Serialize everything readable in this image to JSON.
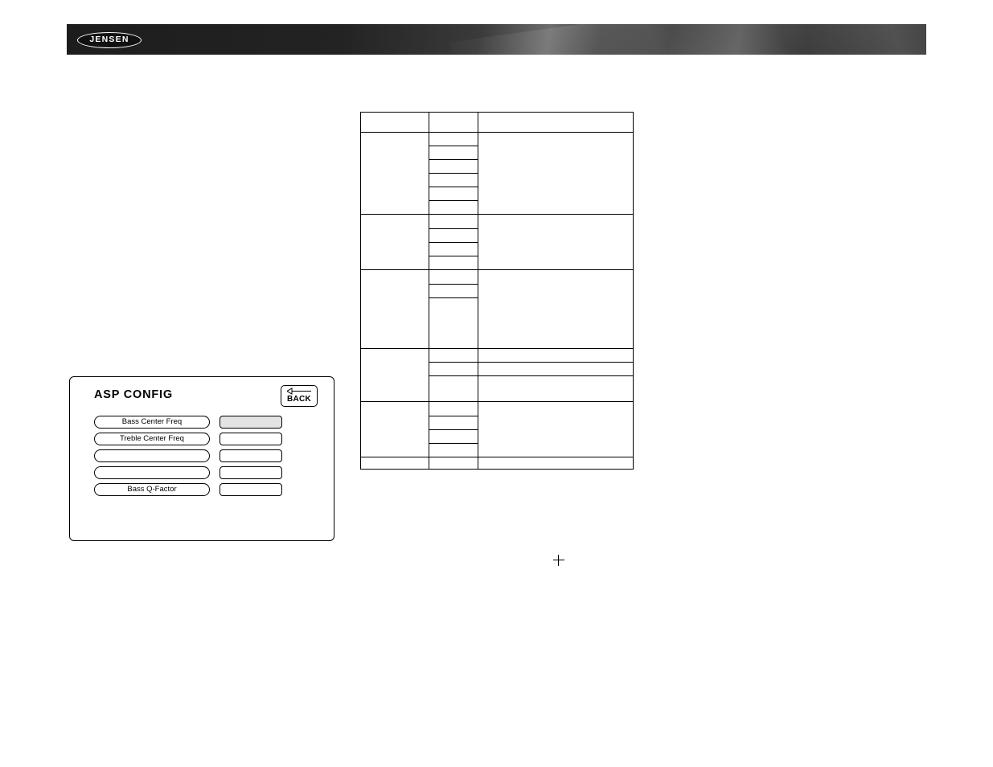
{
  "header": {
    "brand": "JENSEN"
  },
  "asp_panel": {
    "title": "ASP CONFIG",
    "back_label": "BACK",
    "back_icon": "left-arrow-icon",
    "rows": [
      {
        "label": "Bass Center Freq",
        "value": "",
        "value_filled": true
      },
      {
        "label": "Treble Center Freq",
        "value": "",
        "value_filled": false
      },
      {
        "label": "",
        "value": "",
        "value_filled": false
      },
      {
        "label": "",
        "value": "",
        "value_filled": false
      },
      {
        "label": "Bass Q-Factor",
        "value": "",
        "value_filled": false
      }
    ]
  },
  "table": {
    "header": {
      "col_a": "",
      "col_b": "",
      "col_c": ""
    },
    "groups": [
      {
        "label": "",
        "description": "",
        "options": [
          "",
          "",
          "",
          "",
          "",
          ""
        ]
      },
      {
        "label": "",
        "description": "",
        "options": [
          "",
          "",
          "",
          ""
        ]
      },
      {
        "label": "",
        "description": "",
        "options": [
          "",
          "",
          ""
        ]
      },
      {
        "label": "",
        "description": "",
        "options": [
          "",
          "",
          ""
        ],
        "descriptions": [
          "",
          "",
          ""
        ]
      },
      {
        "label": "",
        "description": "",
        "options": [
          "",
          "",
          "",
          ""
        ]
      },
      {
        "label": "",
        "description": "",
        "options": [
          ""
        ]
      }
    ]
  },
  "registration_mark": "crop-cross-icon"
}
